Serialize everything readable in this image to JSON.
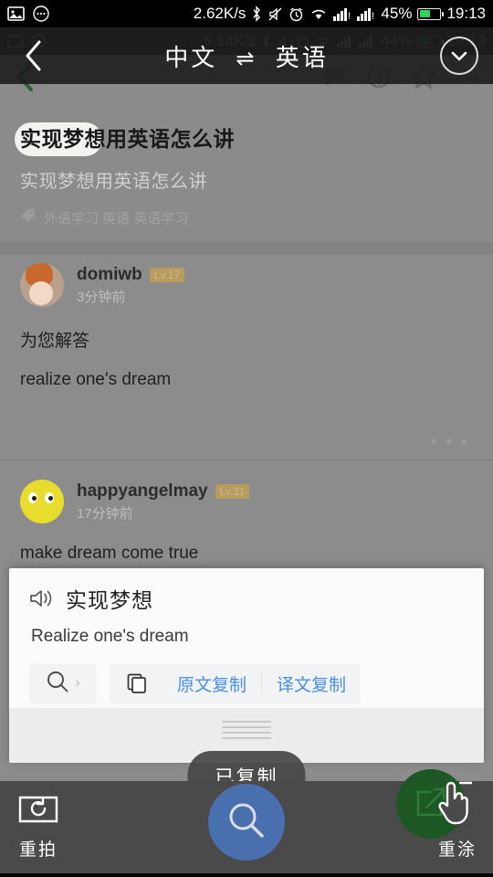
{
  "os_status": {
    "icons_left": [
      "image-icon",
      "message-dots-icon"
    ],
    "network_speed": "2.62K/s",
    "icons_right": [
      "bluetooth-icon",
      "mute-icon",
      "alarm-icon",
      "wifi-icon",
      "signal-1-icon",
      "signal-2-icon"
    ],
    "battery_percent": "45%",
    "time": "19:13",
    "battery_color": "#2fd35a"
  },
  "ghost_status": {
    "network_speed": "5.14K/s",
    "battery_percent": "44%",
    "time": "19:13"
  },
  "overlay_header": {
    "back_icon": "chevron-left-icon",
    "source_language": "中文",
    "swap_symbol": "⇌",
    "target_language": "英语",
    "collapse_icon": "chevron-down-icon"
  },
  "app_toolbar": {
    "back_icon": "chevron-left-icon",
    "tools": [
      "comment-icon",
      "share-icon",
      "star-icon",
      "more-icon"
    ]
  },
  "question": {
    "title": "实现梦想用英语怎么讲",
    "highlighted_text": "实现梦想",
    "subtitle": "实现梦想用英语怎么讲",
    "tag_icon": "tag-icon",
    "tags": "外语学习 英语 英语学习"
  },
  "answers": [
    {
      "avatar": "avatar-photo",
      "username": "domiwb",
      "level": "Lv.17",
      "time": "3分钟前",
      "line1": "为您解答",
      "line2": "realize one's dream",
      "more_icon": "more-dots-icon"
    },
    {
      "avatar": "avatar-smiley",
      "username": "happyangelmay",
      "level": "Lv.11",
      "time": "17分钟前",
      "line1": "make dream come true",
      "line2": "",
      "more_icon": ""
    }
  ],
  "translation_card": {
    "speaker_icon": "speaker-icon",
    "source_text": "实现梦想",
    "translated_text": "Realize one's dream",
    "search_icon": "search-icon",
    "search_chevron": "›",
    "copy_icon": "copy-icon",
    "copy_source_label": "原文复制",
    "copy_translation_label": "译文复制",
    "link_color": "#4a90e2",
    "drag_handle": "drag-handle"
  },
  "toast": {
    "message": "已复制"
  },
  "bottom_bar": {
    "retake_icon": "camera-retake-icon",
    "retake_label": "重拍",
    "search_icon": "search-icon",
    "search_color": "#4a6fae",
    "repaint_icon": "edit-square-icon",
    "repaint_label": "重涂",
    "repaint_color": "#1d5724",
    "cursor": "pointing-hand-cursor"
  }
}
